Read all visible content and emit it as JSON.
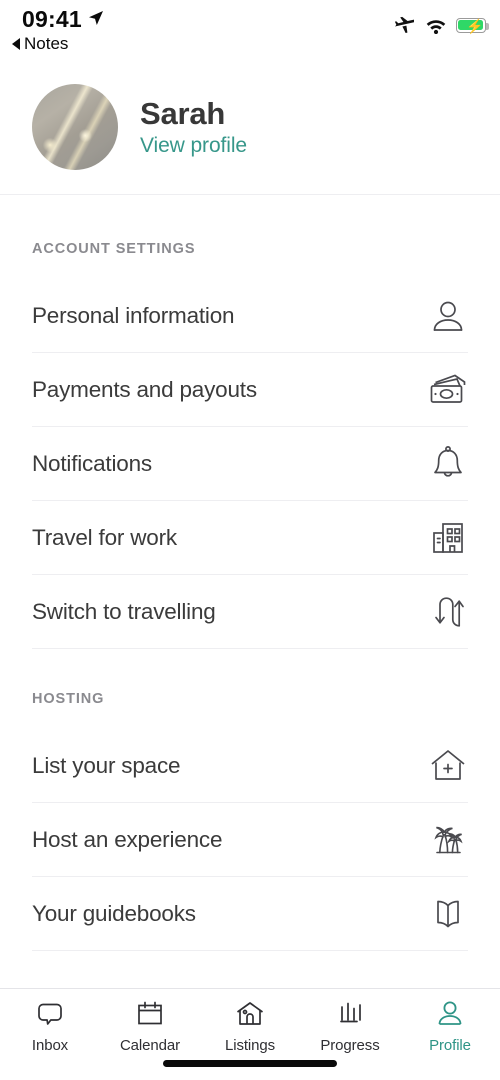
{
  "status_bar": {
    "time": "09:41",
    "back_label": "Notes",
    "location_icon": "location-arrow-icon",
    "airplane_icon": "airplane-mode-icon",
    "wifi_icon": "wifi-icon",
    "battery_icon": "battery-charging-icon"
  },
  "profile": {
    "name": "Sarah",
    "view_profile_label": "View profile",
    "avatar_icon": "avatar",
    "link_color": "#37978a"
  },
  "sections": [
    {
      "title": "ACCOUNT SETTINGS",
      "rows": [
        {
          "label": "Personal information",
          "icon": "person-icon"
        },
        {
          "label": "Payments and payouts",
          "icon": "money-card-icon"
        },
        {
          "label": "Notifications",
          "icon": "bell-icon"
        },
        {
          "label": "Travel for work",
          "icon": "office-building-icon"
        },
        {
          "label": "Switch to travelling",
          "icon": "switch-arrows-icon"
        }
      ]
    },
    {
      "title": "HOSTING",
      "rows": [
        {
          "label": "List your space",
          "icon": "house-plus-icon"
        },
        {
          "label": "Host an experience",
          "icon": "palm-trees-icon"
        },
        {
          "label": "Your guidebooks",
          "icon": "open-book-icon"
        }
      ]
    }
  ],
  "tabbar": {
    "active": "Profile",
    "active_color": "#2e9486",
    "tabs": [
      {
        "label": "Inbox",
        "icon": "speech-bubble-icon"
      },
      {
        "label": "Calendar",
        "icon": "calendar-icon"
      },
      {
        "label": "Listings",
        "icon": "house-icon"
      },
      {
        "label": "Progress",
        "icon": "bar-chart-icon"
      },
      {
        "label": "Profile",
        "icon": "person-icon"
      }
    ]
  }
}
